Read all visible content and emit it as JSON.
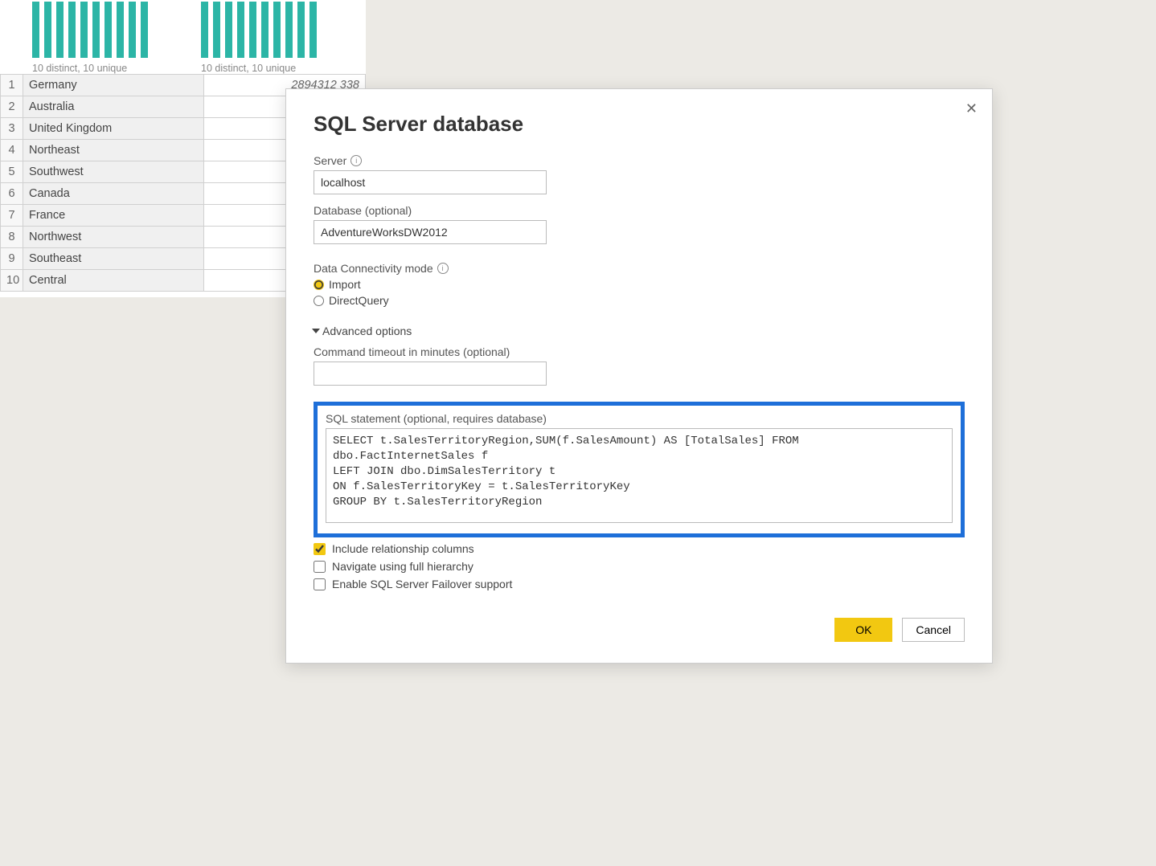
{
  "preview": {
    "distinct_label_1": "10 distinct, 10 unique",
    "distinct_label_2": "10 distinct, 10 unique",
    "top_value": "2894312 338",
    "rows": [
      {
        "n": "1",
        "region": "Germany"
      },
      {
        "n": "2",
        "region": "Australia"
      },
      {
        "n": "3",
        "region": "United Kingdom"
      },
      {
        "n": "4",
        "region": "Northeast"
      },
      {
        "n": "5",
        "region": "Southwest"
      },
      {
        "n": "6",
        "region": "Canada"
      },
      {
        "n": "7",
        "region": "France"
      },
      {
        "n": "8",
        "region": "Northwest"
      },
      {
        "n": "9",
        "region": "Southeast"
      },
      {
        "n": "10",
        "region": "Central"
      }
    ]
  },
  "dialog": {
    "title": "SQL Server database",
    "server_label": "Server",
    "server_value": "localhost",
    "database_label": "Database (optional)",
    "database_value": "AdventureWorksDW2012",
    "conn_mode_label": "Data Connectivity mode",
    "import_label": "Import",
    "directquery_label": "DirectQuery",
    "adv_label": "Advanced options",
    "timeout_label": "Command timeout in minutes (optional)",
    "timeout_value": "",
    "sql_label": "SQL statement (optional, requires database)",
    "sql_value": "SELECT t.SalesTerritoryRegion,SUM(f.SalesAmount) AS [TotalSales] FROM dbo.FactInternetSales f\nLEFT JOIN dbo.DimSalesTerritory t\nON f.SalesTerritoryKey = t.SalesTerritoryKey\nGROUP BY t.SalesTerritoryRegion",
    "include_rel_label": "Include relationship columns",
    "nav_full_label": "Navigate using full hierarchy",
    "failover_label": "Enable SQL Server Failover support",
    "ok_label": "OK",
    "cancel_label": "Cancel"
  }
}
